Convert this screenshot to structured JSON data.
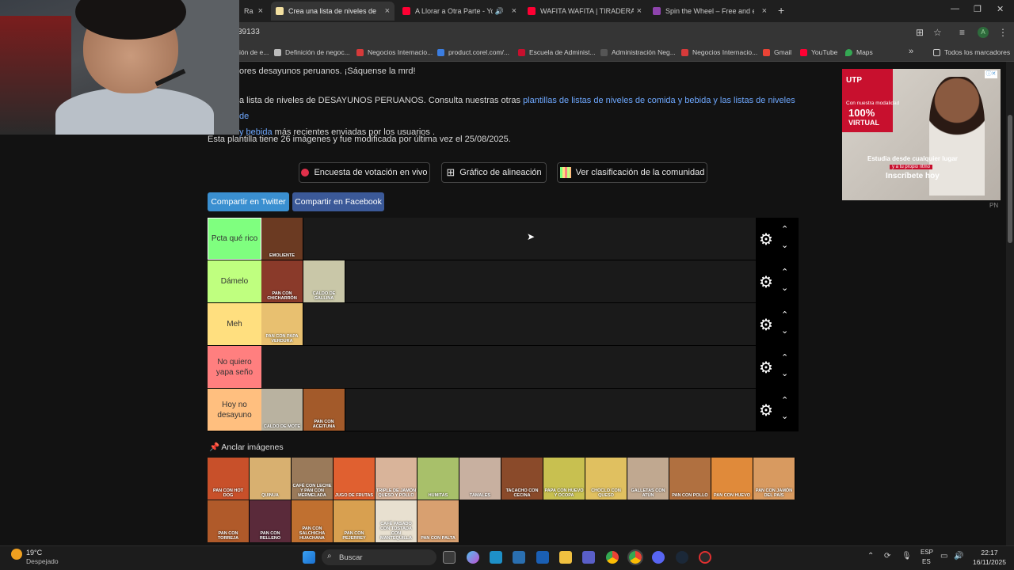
{
  "browser": {
    "tabs": [
      {
        "label": "Ra",
        "active": false,
        "favicon_color": "#e0e0e0"
      },
      {
        "label": "Crea una lista de niveles de DES",
        "active": true,
        "favicon_color": "#f3e0a0"
      },
      {
        "label": "A Llorar a Otra Parte - YouT",
        "active": false,
        "favicon_color": "#ff0033"
      },
      {
        "label": "WAFITA WAFITA | TIRADERA A",
        "active": false,
        "favicon_color": "#ff0033"
      },
      {
        "label": "Spin the Wheel – Free and easy",
        "active": false,
        "favicon_color": "#8e44ad"
      }
    ],
    "new_tab": "+",
    "close_glyph": "×",
    "url": "39133",
    "profile_initial": "A",
    "bookmarks": [
      {
        "label": "ión de e...",
        "color": "#999"
      },
      {
        "label": "Definición de negoc...",
        "color": "#bbb"
      },
      {
        "label": "Negocios Internacio...",
        "color": "#d63a3a"
      },
      {
        "label": "product.corel.com/...",
        "color": "#3b7de0"
      },
      {
        "label": "Escuela de Administ...",
        "color": "#c8102e"
      },
      {
        "label": "Administración Neg...",
        "color": "#777"
      },
      {
        "label": "Negocios Internacio...",
        "color": "#d63a3a"
      },
      {
        "label": "Gmail",
        "color": "#ea4335"
      },
      {
        "label": "YouTube",
        "color": "#ff0033"
      },
      {
        "label": "Maps",
        "color": "#34a853"
      }
    ],
    "bookmarks_overflow": "»",
    "all_bookmarks": "Todos los marcadores"
  },
  "page": {
    "intro_partial": "ores desayunos peruanos. ¡Sáquense la mrd!",
    "desc_text": "a lista de niveles de DESAYUNOS PERUANOS. Consulta nuestras otras ",
    "desc_link1": "plantillas de listas de niveles de comida y bebida y las listas de niveles de",
    "desc_link2": "y bebida",
    "desc_tail": " más recientes enviadas por los usuarios .",
    "template_info": "Esta plantilla tiene 26 imágenes y fue modificada por última vez el 25/08/2025.",
    "buttons": {
      "poll": "Encuesta de votación en vivo",
      "alignment": "Gráfico de alineación",
      "community": "Ver clasificación de la comunidad"
    },
    "share": {
      "twitter": "Compartir en Twitter",
      "facebook": "Compartir en Facebook"
    },
    "tiers": [
      {
        "label": "Pcta qué rico",
        "color": "#7fff7f",
        "items": [
          {
            "caption": "EMOLIENTE",
            "bg": "#6b3a22"
          }
        ]
      },
      {
        "label": "Dámelo",
        "color": "#bfff7f",
        "items": [
          {
            "caption": "PAN CON CHICHARRÓN",
            "bg": "#8a3a2a"
          },
          {
            "caption": "CALDO DE GALLINA",
            "bg": "#c9c7a8"
          }
        ]
      },
      {
        "label": "Meh",
        "color": "#ffdf7f",
        "items": [
          {
            "caption": "PAN CON PAPA VERDURA",
            "bg": "#e8c070"
          }
        ]
      },
      {
        "label": "No quiero yapa seño",
        "color": "#ff7f7f",
        "items": []
      },
      {
        "label": "Hoy no desayuno",
        "color": "#ffbf7f",
        "items": [
          {
            "caption": "CALDO DE MOTE",
            "bg": "#b9b2a0"
          },
          {
            "caption": "PAN CON ACEITUNA",
            "bg": "#a35a2a"
          }
        ]
      }
    ],
    "anchor_label": "Anclar imágenes",
    "pool_row1": [
      {
        "caption": "PAN CON HOT DOG",
        "bg": "#c8502a"
      },
      {
        "caption": "QUINUA",
        "bg": "#d8b070"
      },
      {
        "caption": "CAFÉ CON LECHE Y PAN CON MERMELADA",
        "bg": "#9a7a5a"
      },
      {
        "caption": "JUGO DE FRUTAS",
        "bg": "#e06030"
      },
      {
        "caption": "TRIPLE DE JAMÓN QUESO Y POLLO",
        "bg": "#d9b49a"
      },
      {
        "caption": "HUMITAS",
        "bg": "#a8c06a"
      },
      {
        "caption": "TAMALES",
        "bg": "#c8b0a0"
      },
      {
        "caption": "TACACHO CON CECINA",
        "bg": "#8a4a2a"
      },
      {
        "caption": "PAPA CON HUEVO Y OCOPA",
        "bg": "#c8c050"
      },
      {
        "caption": "CHOCLO CON QUESO",
        "bg": "#e0c060"
      },
      {
        "caption": "GALLETAS CON ATÚN",
        "bg": "#c0a890"
      },
      {
        "caption": "PAN CON POLLO",
        "bg": "#b07040"
      },
      {
        "caption": "PAN CON HUEVO",
        "bg": "#e08a3a"
      },
      {
        "caption": "PAN CON JAMÓN DEL PAÍS",
        "bg": "#d89a60"
      }
    ],
    "pool_row2": [
      {
        "caption": "PAN CON TORREJA",
        "bg": "#b05a2a"
      },
      {
        "caption": "PAN CON RELLENO",
        "bg": "#5a2a3a"
      },
      {
        "caption": "PAN CON SALCHICHA HUACHANA",
        "bg": "#c07030"
      },
      {
        "caption": "PAN CON PEJERREY",
        "bg": "#d8a050"
      },
      {
        "caption": "CAFÉ PASADO CON TOSTADA CON MANTEQUILLA",
        "bg": "#e8e0d0"
      },
      {
        "caption": "PAN CON PALTA",
        "bg": "#d8a070"
      }
    ]
  },
  "ad": {
    "brand": "UTP",
    "modality": "Con nuestra modalidad",
    "percent": "100%",
    "virtual": "VIRTUAL",
    "study": "Estudia desde cualquier lugar",
    "rhythm": "y a tu propio ritmo",
    "enroll": "Inscríbete hoy",
    "badge": "PN"
  },
  "taskbar": {
    "weather_temp": "19°C",
    "weather_desc": "Despejado",
    "search_placeholder": "Buscar",
    "lang1": "ESP",
    "lang2": "ES",
    "time": "22:17",
    "date": "16/11/2025"
  }
}
